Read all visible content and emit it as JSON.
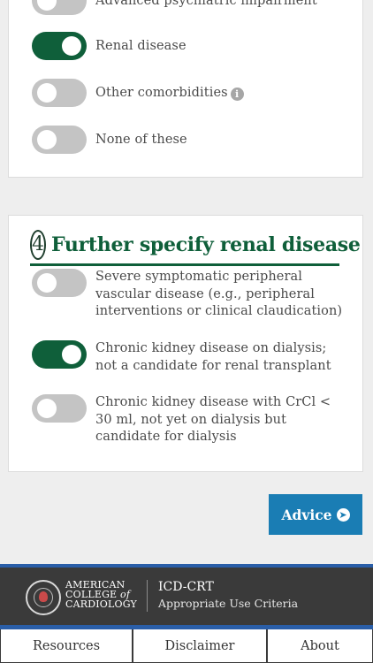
{
  "section3": {
    "options": [
      {
        "label": "Advanced psychiatric impairment",
        "on": false
      },
      {
        "label": "Renal disease",
        "on": true
      },
      {
        "label": "Other comorbidities",
        "on": false,
        "info_icon": "info-icon"
      },
      {
        "label": "None of these",
        "on": false
      }
    ]
  },
  "section4": {
    "step_number": "4",
    "title": "Further specify renal disease",
    "options": [
      {
        "label": "Severe symptomatic peripheral vascular disease (e.g., peripheral interventions or clinical claudication)",
        "on": false
      },
      {
        "label": "Chronic kidney disease on dialysis; not a candidate for renal transplant",
        "on": true
      },
      {
        "label": "Chronic kidney disease with CrCl < 30 ml, not yet on dialysis but candidate for dialysis",
        "on": false
      }
    ]
  },
  "advice_button": {
    "label": "Advice",
    "icon": "arrow-right-circle-icon"
  },
  "footer": {
    "org_line1": "AMERICAN",
    "org_line2a": "COLLEGE",
    "org_line2b": "of",
    "org_line3": "CARDIOLOGY",
    "app_name": "ICD-CRT",
    "app_subtitle": "Appropriate Use Criteria"
  },
  "tabs": [
    {
      "label": "Resources"
    },
    {
      "label": "Disclaimer"
    },
    {
      "label": "About"
    }
  ],
  "colors": {
    "toggle_on": "#0f5f3a",
    "toggle_off": "#c4c4c4",
    "accent_green": "#0f5f3a",
    "advice_blue": "#1a7db4",
    "footer_bg": "#3a3a3a",
    "footer_accent": "#2a5ea8"
  }
}
